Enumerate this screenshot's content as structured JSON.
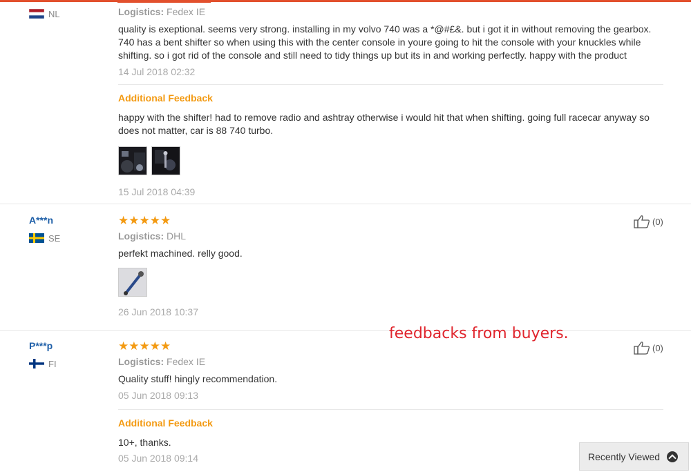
{
  "reviews": [
    {
      "user": "",
      "country": "NL",
      "stars": "",
      "logistics_label": "Logistics:",
      "logistics": "Fedex IE",
      "text": "quality is exeptional. seems very strong. installing in my volvo 740 was a *@#£&. but i got it in without removing the gearbox. 740 has a bent shifter so when using this with the center console in youre going to hit the console with your knuckles while shifting. so i got rid of the console and still need to tidy things up but its in and working perfectly. happy with the product",
      "date": "14 Jul 2018 02:32",
      "additional_label": "Additional Feedback",
      "additional_text": "happy with the shifter! had to remove radio and ashtray otherwise i would hit that when shifting. going full racecar anyway so does not matter, car is 88 740 turbo.",
      "additional_date": "15 Jul 2018 04:39"
    },
    {
      "user": "A***n",
      "country": "SE",
      "stars": "★★★★★",
      "logistics_label": "Logistics:",
      "logistics": "DHL",
      "text": "perfekt machined. relly good.",
      "date": "26 Jun 2018 10:37",
      "likes": "(0)"
    },
    {
      "user": "P***p",
      "country": "FI",
      "stars": "★★★★★",
      "logistics_label": "Logistics:",
      "logistics": "Fedex IE",
      "text": "Quality stuff! hingly recommendation.",
      "date": "05 Jun 2018 09:13",
      "likes": "(0)",
      "additional_label": "Additional Feedback",
      "additional_text": "10+, thanks.",
      "additional_date": "05 Jun 2018 09:14"
    }
  ],
  "watermark": "feedbacks from buyers.",
  "recently_viewed": "Recently Viewed",
  "colors": {
    "accent": "#e2502d",
    "star": "#f39a12",
    "link": "#1e5fa8",
    "watermark": "#e0262e"
  }
}
